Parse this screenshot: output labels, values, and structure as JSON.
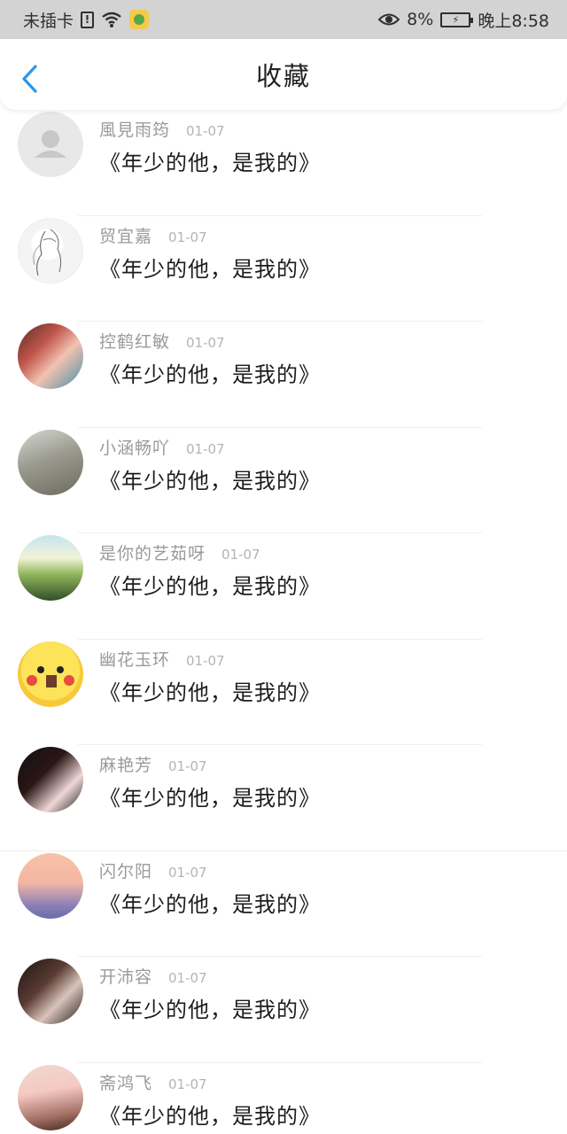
{
  "statusbar": {
    "carrier": "未插卡",
    "sim_alert": "!",
    "battery_percent": "8%",
    "time": "晚上8:58",
    "icons": [
      "sim-alert-icon",
      "wifi-icon",
      "app-notification-icon",
      "eye-icon",
      "battery-charging-icon"
    ]
  },
  "header": {
    "title": "收藏",
    "back_icon": "chevron-left-icon",
    "accent": "#2a98e6"
  },
  "favorites": [
    {
      "user": "風見雨筠",
      "date": "01-07",
      "title": "《年少的他，是我的》",
      "avatar": "default-avatar"
    },
    {
      "user": "贸宜嘉",
      "date": "01-07",
      "title": "《年少的他，是我的》",
      "avatar": "sketch-avatar"
    },
    {
      "user": "控鹤红敏",
      "date": "01-07",
      "title": "《年少的他，是我的》",
      "avatar": "photo-avatar"
    },
    {
      "user": "小涵畅吖",
      "date": "01-07",
      "title": "《年少的他，是我的》",
      "avatar": "photo-avatar"
    },
    {
      "user": "是你的艺茹呀",
      "date": "01-07",
      "title": "《年少的他，是我的》",
      "avatar": "landscape-avatar"
    },
    {
      "user": "幽花玉环",
      "date": "01-07",
      "title": "《年少的他，是我的》",
      "avatar": "pikachu-avatar"
    },
    {
      "user": "麻艳芳",
      "date": "01-07",
      "title": "《年少的他，是我的》",
      "avatar": "photo-avatar"
    },
    {
      "user": "闪尔阳",
      "date": "01-07",
      "title": "《年少的他，是我的》",
      "avatar": "sunset-avatar"
    },
    {
      "user": "开沛容",
      "date": "01-07",
      "title": "《年少的他，是我的》",
      "avatar": "photo-avatar"
    },
    {
      "user": "斋鸿飞",
      "date": "01-07",
      "title": "《年少的他，是我的》",
      "avatar": "photo-avatar"
    }
  ]
}
